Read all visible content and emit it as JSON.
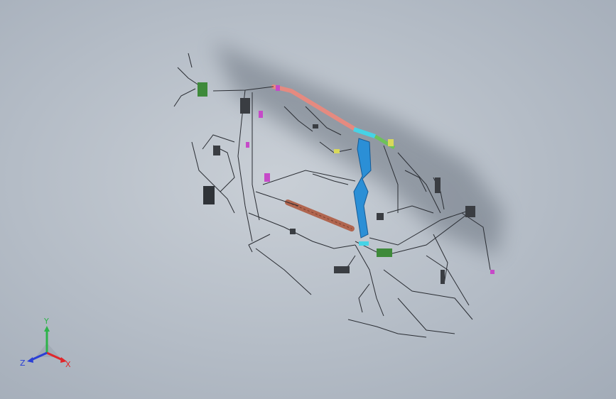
{
  "app": {
    "kind": "cad-3d-viewport",
    "background_top": "#c9cfd6",
    "background_bottom": "#a3acb8"
  },
  "model": {
    "subject": "wire-harness-assembly",
    "colors": {
      "wire": "#2a2d33",
      "trunk_upper": "#e58a80",
      "trunk_lower": "#b0654f",
      "cross_member": "#2b8fd6",
      "connector_cyan": "#46d3e6",
      "connector_green": "#3e8a3a",
      "connector_magenta": "#c64ac8",
      "connector_yellow": "#d8d85a"
    }
  },
  "triad": {
    "x_label": "X",
    "y_label": "Y",
    "z_label": "Z",
    "x_color": "#e0262b",
    "y_color": "#2db34a",
    "z_color": "#2a3fd6"
  }
}
